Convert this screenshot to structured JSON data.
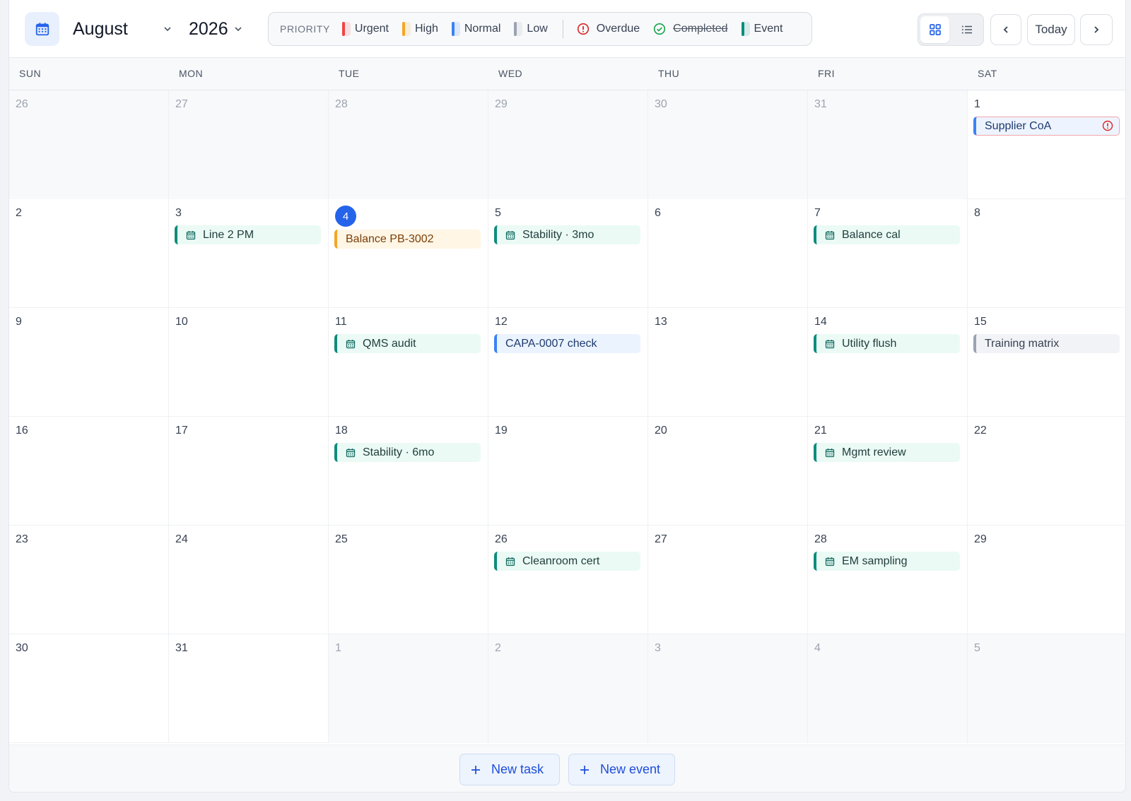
{
  "header": {
    "calendar_icon": "calendar-icon",
    "month": "August",
    "year": "2026",
    "legend_caption": "PRIORITY",
    "legend": [
      {
        "label": "Urgent",
        "color": "#ef4444"
      },
      {
        "label": "High",
        "color": "#f5a524"
      },
      {
        "label": "Normal",
        "color": "#3b82f6"
      },
      {
        "label": "Low",
        "color": "#9aa3b2"
      }
    ],
    "status_legend": {
      "overdue": "Overdue",
      "completed": "Completed",
      "event": "Event"
    },
    "view_grid_icon": "grid-view-icon",
    "view_list_icon": "list-view-icon",
    "prev_icon": "chevron-left-icon",
    "today_label": "Today",
    "next_icon": "chevron-right-icon"
  },
  "weekdays": [
    "SUN",
    "MON",
    "TUE",
    "WED",
    "THU",
    "FRI",
    "SAT"
  ],
  "weeks": [
    [
      {
        "day": "26",
        "out": true
      },
      {
        "day": "27",
        "out": true
      },
      {
        "day": "28",
        "out": true
      },
      {
        "day": "29",
        "out": true
      },
      {
        "day": "30",
        "out": true
      },
      {
        "day": "31",
        "out": true
      },
      {
        "day": "1",
        "items": [
          {
            "label": "Supplier CoA",
            "kind": "overdue"
          }
        ]
      }
    ],
    [
      {
        "day": "2"
      },
      {
        "day": "3",
        "items": [
          {
            "label": "Line 2 PM",
            "kind": "event"
          }
        ]
      },
      {
        "day": "4",
        "today": true,
        "items": [
          {
            "label": "Balance PB-3002",
            "kind": "high"
          }
        ]
      },
      {
        "day": "5",
        "items": [
          {
            "label": "Stability · 3mo",
            "kind": "event"
          }
        ]
      },
      {
        "day": "6"
      },
      {
        "day": "7",
        "items": [
          {
            "label": "Balance cal",
            "kind": "event"
          }
        ]
      },
      {
        "day": "8"
      }
    ],
    [
      {
        "day": "9"
      },
      {
        "day": "10"
      },
      {
        "day": "11",
        "items": [
          {
            "label": "QMS audit",
            "kind": "event"
          }
        ]
      },
      {
        "day": "12",
        "items": [
          {
            "label": "CAPA-0007 check",
            "kind": "normal"
          }
        ]
      },
      {
        "day": "13"
      },
      {
        "day": "14",
        "items": [
          {
            "label": "Utility flush",
            "kind": "event"
          }
        ]
      },
      {
        "day": "15",
        "items": [
          {
            "label": "Training matrix",
            "kind": "low"
          }
        ]
      }
    ],
    [
      {
        "day": "16"
      },
      {
        "day": "17"
      },
      {
        "day": "18",
        "items": [
          {
            "label": "Stability · 6mo",
            "kind": "event"
          }
        ]
      },
      {
        "day": "19"
      },
      {
        "day": "20"
      },
      {
        "day": "21",
        "items": [
          {
            "label": "Mgmt review",
            "kind": "event"
          }
        ]
      },
      {
        "day": "22"
      }
    ],
    [
      {
        "day": "23"
      },
      {
        "day": "24"
      },
      {
        "day": "25"
      },
      {
        "day": "26",
        "items": [
          {
            "label": "Cleanroom cert",
            "kind": "event"
          }
        ]
      },
      {
        "day": "27"
      },
      {
        "day": "28",
        "items": [
          {
            "label": "EM sampling",
            "kind": "event"
          }
        ]
      },
      {
        "day": "29"
      }
    ],
    [
      {
        "day": "30"
      },
      {
        "day": "31"
      },
      {
        "day": "1",
        "out": true
      },
      {
        "day": "2",
        "out": true
      },
      {
        "day": "3",
        "out": true
      },
      {
        "day": "4",
        "out": true
      },
      {
        "day": "5",
        "out": true
      }
    ]
  ],
  "footer": {
    "new_task": "New task",
    "new_event": "New event",
    "plus_icon": "plus-icon"
  }
}
